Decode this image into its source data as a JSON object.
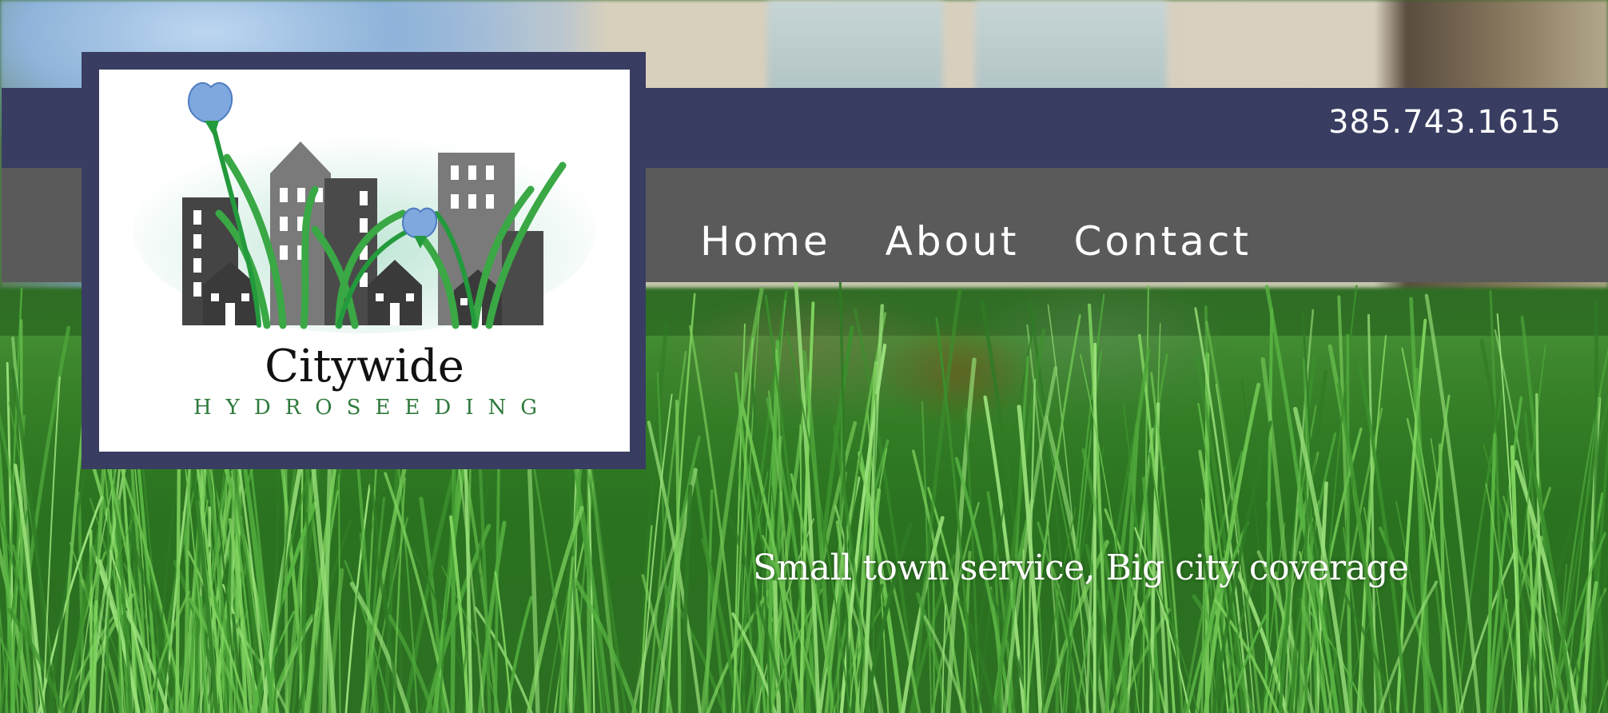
{
  "header": {
    "phone": "385.743.1615"
  },
  "nav": {
    "items": [
      {
        "label": "Home"
      },
      {
        "label": "About"
      },
      {
        "label": "Contact"
      }
    ]
  },
  "logo": {
    "name": "Citywide",
    "subtitle": "HYDROSEEDING",
    "icon": "city-skyline-with-grass-and-flowers-icon"
  },
  "hero": {
    "tagline": "Small town service, Big city coverage"
  },
  "colors": {
    "header_bar": "#383d61",
    "nav_bar": "#5a5a5a",
    "logo_subtitle": "#2e7a3c",
    "grass_green": "#3f8b2e"
  }
}
